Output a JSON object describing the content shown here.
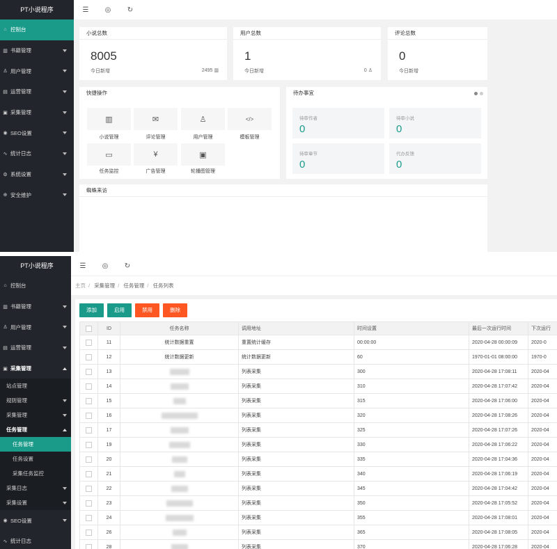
{
  "app_title": "PT小说程序",
  "sidebar1": [
    {
      "icon": "⌂",
      "label": "控制台",
      "active": true,
      "arrow": false
    },
    {
      "icon": "▥",
      "label": "书籍管理",
      "arrow": true
    },
    {
      "icon": "♙",
      "label": "用户管理",
      "arrow": true
    },
    {
      "icon": "▤",
      "label": "运营管理",
      "arrow": true
    },
    {
      "icon": "▣",
      "label": "采集管理",
      "arrow": true
    },
    {
      "icon": "◉",
      "label": "SEO设置",
      "arrow": true
    },
    {
      "icon": "∿",
      "label": "统计日志",
      "arrow": true
    },
    {
      "icon": "⚙",
      "label": "系统设置",
      "arrow": true
    },
    {
      "icon": "⊕",
      "label": "安全维护",
      "arrow": true
    }
  ],
  "stats": [
    {
      "title": "小说总数",
      "value": "8005",
      "sub": "今日新增",
      "right": "2495"
    },
    {
      "title": "用户总数",
      "value": "1",
      "sub": "今日新增",
      "right": "0"
    },
    {
      "title": "评论总数",
      "value": "0",
      "sub": "今日新增",
      "right": ""
    }
  ],
  "quick": {
    "title": "快捷操作",
    "items": [
      "小说管理",
      "评论管理",
      "用户管理",
      "模板管理",
      "任务监控",
      "广告管理",
      "轮播图管理"
    ]
  },
  "todo": {
    "title": "待办事宜",
    "items": [
      {
        "label": "待审作者",
        "value": "0"
      },
      {
        "label": "待审小说",
        "value": "0"
      },
      {
        "label": "待审章节",
        "value": "0"
      },
      {
        "label": "代办反馈",
        "value": "0"
      }
    ]
  },
  "spider_title": "蜘蛛来访",
  "sidebar2": {
    "top": [
      {
        "icon": "⌂",
        "label": "控制台",
        "arrow": false
      },
      {
        "icon": "▥",
        "label": "书籍管理",
        "arrow": true
      },
      {
        "icon": "♙",
        "label": "用户管理",
        "arrow": true
      },
      {
        "icon": "▤",
        "label": "运营管理",
        "arrow": true
      },
      {
        "icon": "▣",
        "label": "采集管理",
        "arrow": "up",
        "bold": true
      }
    ],
    "sub": [
      "站点管理",
      "规则管理",
      "采集管理",
      "任务管理",
      "任务管理",
      "任务设置",
      "采集任务监控",
      "采集日志",
      "采集设置"
    ],
    "bottom": [
      {
        "icon": "◉",
        "label": "SEO设置",
        "arrow": true
      },
      {
        "icon": "∿",
        "label": "统计日志",
        "arrow": false
      }
    ]
  },
  "breadcrumb": [
    "主页",
    "采集管理",
    "任务管理",
    "任务列表"
  ],
  "buttons": {
    "add": "添加",
    "enable": "启用",
    "disable": "禁用",
    "delete": "删除"
  },
  "table": {
    "headers": [
      "ID",
      "任务名称",
      "调用地址",
      "时间设置",
      "最后一次运行时间",
      "下次运行"
    ],
    "rows": [
      {
        "id": "11",
        "name": "统计数据重置",
        "addr": "重置统计缓存",
        "time": "00:00:00",
        "last": "2020-04-28 00:00:09",
        "next": "2020-0"
      },
      {
        "id": "12",
        "name": "统计数据更新",
        "addr": "统计数据更新",
        "time": "60",
        "last": "1970-01-01 08:00:00",
        "next": "1970-0"
      },
      {
        "id": "13",
        "name": "",
        "addr": "列表采集",
        "time": "300",
        "last": "2020-04-28 17:08:11",
        "next": "2020-04"
      },
      {
        "id": "14",
        "name": "",
        "addr": "列表采集",
        "time": "310",
        "last": "2020-04-28 17:07:42",
        "next": "2020-04"
      },
      {
        "id": "15",
        "name": "",
        "addr": "列表采集",
        "time": "315",
        "last": "2020-04-28 17:06:00",
        "next": "2020-04"
      },
      {
        "id": "16",
        "name": "",
        "addr": "列表采集",
        "time": "320",
        "last": "2020-04-28 17:08:26",
        "next": "2020-04"
      },
      {
        "id": "17",
        "name": "",
        "addr": "列表采集",
        "time": "325",
        "last": "2020-04-28 17:07:26",
        "next": "2020-04"
      },
      {
        "id": "19",
        "name": "",
        "addr": "列表采集",
        "time": "330",
        "last": "2020-04-28 17:06:22",
        "next": "2020-04"
      },
      {
        "id": "20",
        "name": "",
        "addr": "列表采集",
        "time": "335",
        "last": "2020-04-28 17:04:36",
        "next": "2020-04"
      },
      {
        "id": "21",
        "name": "",
        "addr": "列表采集",
        "time": "340",
        "last": "2020-04-28 17:06:19",
        "next": "2020-04"
      },
      {
        "id": "22",
        "name": "",
        "addr": "列表采集",
        "time": "345",
        "last": "2020-04-28 17:04:42",
        "next": "2020-04"
      },
      {
        "id": "23",
        "name": "",
        "addr": "列表采集",
        "time": "350",
        "last": "2020-04-28 17:05:52",
        "next": "2020-04"
      },
      {
        "id": "24",
        "name": "",
        "addr": "列表采集",
        "time": "355",
        "last": "2020-04-28 17:08:01",
        "next": "2020-04"
      },
      {
        "id": "26",
        "name": "",
        "addr": "列表采集",
        "time": "365",
        "last": "2020-04-28 17:08:05",
        "next": "2020-04"
      },
      {
        "id": "28",
        "name": "",
        "addr": "列表采集",
        "time": "370",
        "last": "2020-04-28 17:06:28",
        "next": "2020-04"
      }
    ]
  }
}
